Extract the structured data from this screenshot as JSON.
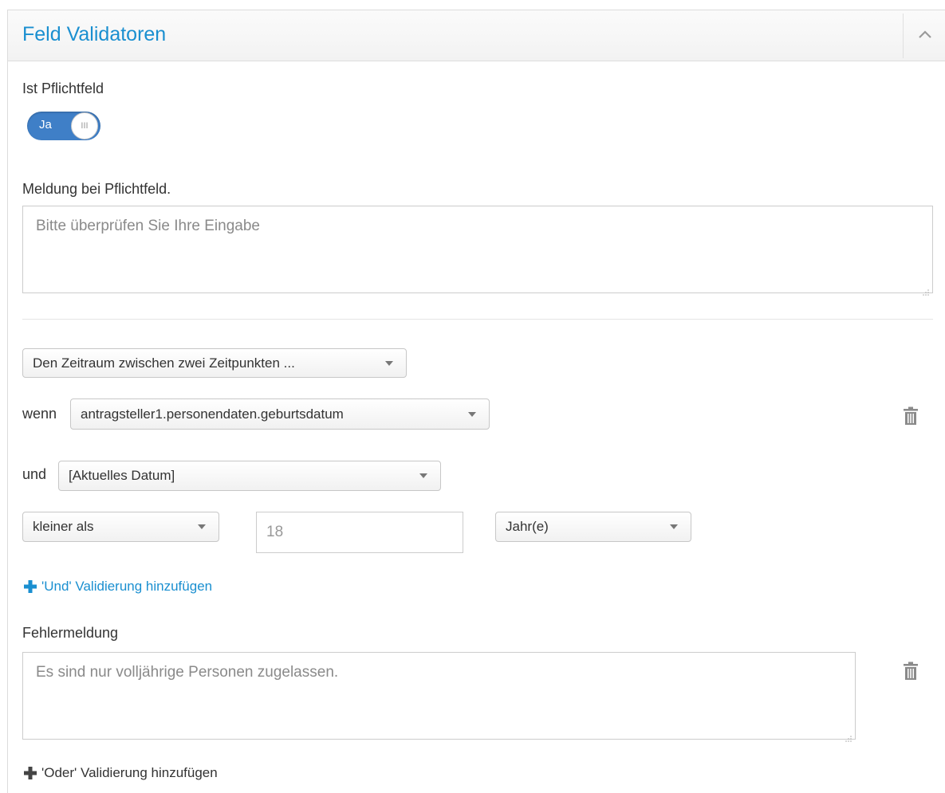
{
  "panel": {
    "title": "Feld Validatoren",
    "collapse_icon": "chevron-up-icon"
  },
  "required": {
    "label": "Ist Pflichtfeld",
    "toggle_text": "Ja",
    "toggle_knob_text": "III",
    "toggle_on": true
  },
  "required_message": {
    "label": "Meldung bei Pflichtfeld.",
    "placeholder": "Bitte überprüfen Sie Ihre Eingabe"
  },
  "validation": {
    "type_select": "Den Zeitraum zwischen zwei Zeitpunkten ...",
    "when_label": "wenn",
    "when_select": "antragsteller1.personendaten.geburtsdatum",
    "and_label": "und",
    "and_select": "[Aktuelles Datum]",
    "operator_select": "kleiner als",
    "value_placeholder": "18",
    "unit_select": "Jahr(e)",
    "add_and_link": "'Und' Validierung hinzufügen",
    "error_label": "Fehlermeldung",
    "error_placeholder": "Es sind nur volljährige Personen zugelassen.",
    "add_or_link": "'Oder' Validierung hinzufügen"
  },
  "colors": {
    "accent": "#1a8fd0",
    "toggle": "#3f7fc7"
  }
}
